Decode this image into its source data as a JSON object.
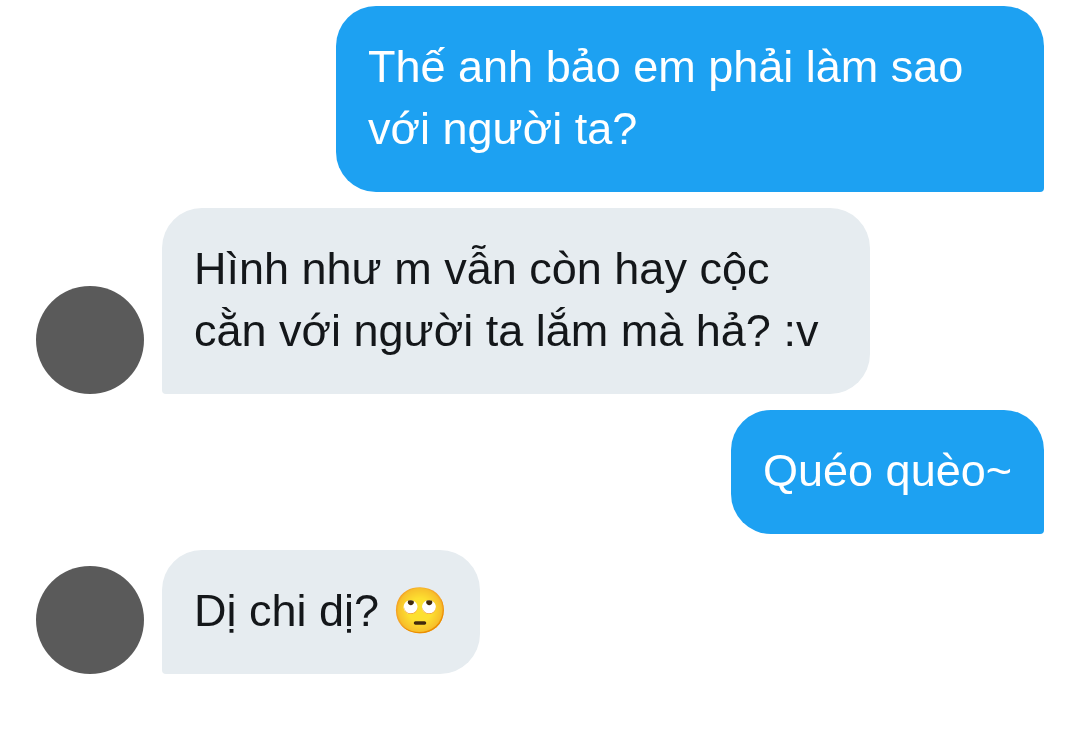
{
  "messages": [
    {
      "kind": "sent",
      "text": "Thế anh bảo em phải làm sao với người ta?"
    },
    {
      "kind": "received",
      "text": "Hình như m vẫn còn hay cộc cằn với người ta lắm mà hả? :v"
    },
    {
      "kind": "sent",
      "text": "Quéo quèo~"
    },
    {
      "kind": "received",
      "text": "Dị chi dị? 🙄"
    }
  ]
}
